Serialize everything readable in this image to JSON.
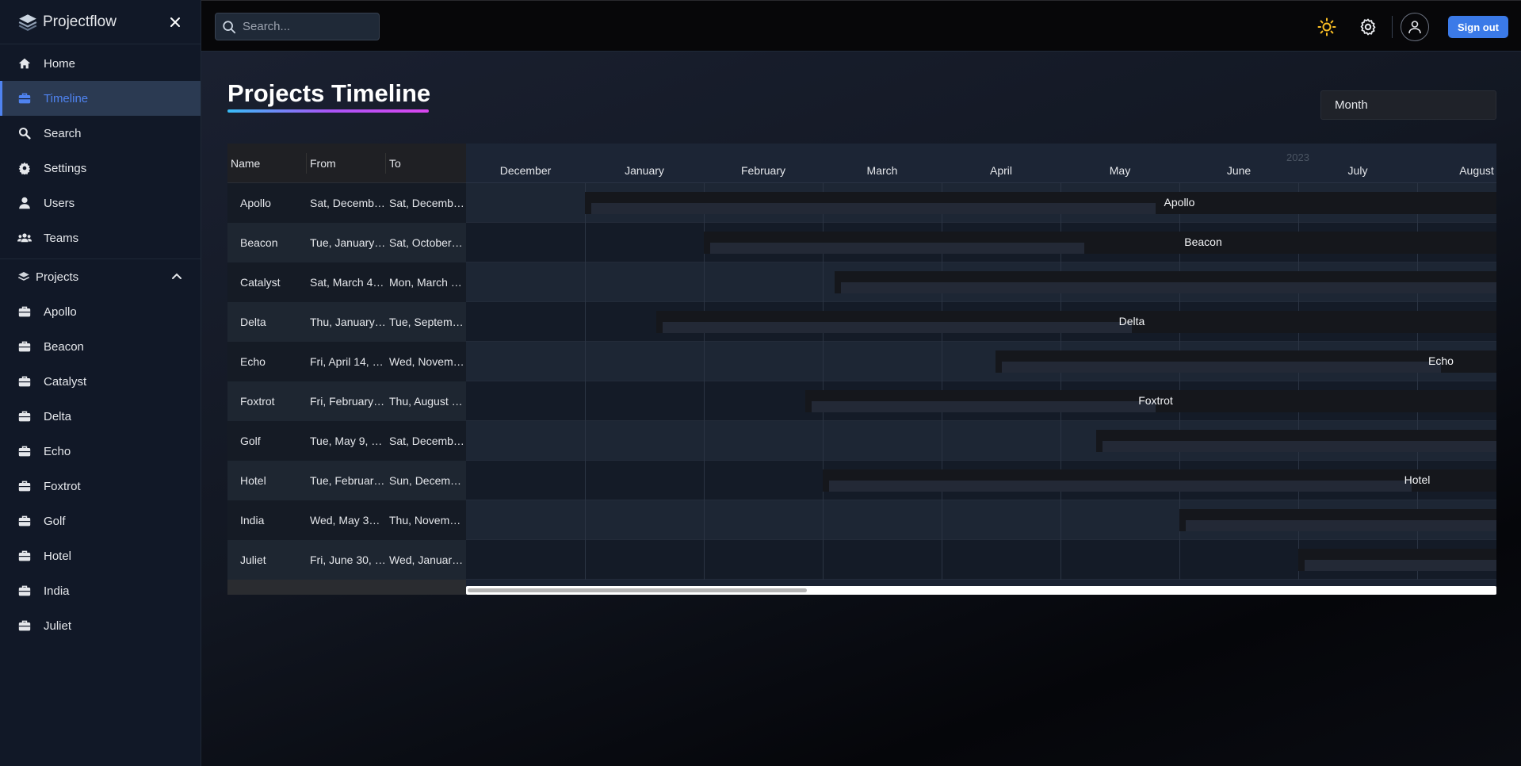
{
  "app": {
    "name": "Projectflow"
  },
  "search": {
    "placeholder": "Search..."
  },
  "nav": [
    {
      "label": "Home",
      "icon": "home-icon"
    },
    {
      "label": "Timeline",
      "icon": "briefcase-icon",
      "active": true
    },
    {
      "label": "Search",
      "icon": "search-icon"
    },
    {
      "label": "Settings",
      "icon": "gear-icon"
    },
    {
      "label": "Users",
      "icon": "user-icon"
    },
    {
      "label": "Teams",
      "icon": "users-icon"
    }
  ],
  "projects_header": "Projects",
  "projects": [
    "Apollo",
    "Beacon",
    "Catalyst",
    "Delta",
    "Echo",
    "Foxtrot",
    "Golf",
    "Hotel",
    "India",
    "Juliet"
  ],
  "topbar": {
    "signout": "Sign out"
  },
  "page": {
    "title": "Projects Timeline",
    "view": "Month"
  },
  "table": {
    "headers": {
      "name": "Name",
      "from": "From",
      "to": "To"
    },
    "rows": [
      {
        "name": "Apollo",
        "from": "Sat, Decemb…",
        "to": "Sat, Decemb…"
      },
      {
        "name": "Beacon",
        "from": "Tue, January…",
        "to": "Sat, October…"
      },
      {
        "name": "Catalyst",
        "from": "Sat, March 4…",
        "to": "Mon, March …"
      },
      {
        "name": "Delta",
        "from": "Thu, January…",
        "to": "Tue, Septem…"
      },
      {
        "name": "Echo",
        "from": "Fri, April 14, …",
        "to": "Wed, Novem…"
      },
      {
        "name": "Foxtrot",
        "from": "Fri, February…",
        "to": "Thu, August …"
      },
      {
        "name": "Golf",
        "from": "Tue, May 9, …",
        "to": "Sat, Decemb…"
      },
      {
        "name": "Hotel",
        "from": "Tue, Februar…",
        "to": "Sun, Decem…"
      },
      {
        "name": "India",
        "from": "Wed, May 3…",
        "to": "Thu, Novem…"
      },
      {
        "name": "Juliet",
        "from": "Fri, June 30, …",
        "to": "Wed, Januar…"
      }
    ]
  },
  "timeline": {
    "year": "2023",
    "months": [
      "December",
      "January",
      "February",
      "March",
      "April",
      "May",
      "June",
      "July",
      "August"
    ],
    "bars": [
      {
        "label": "Apollo",
        "start": 1.0,
        "end": 8.7,
        "fill_end": 5.8
      },
      {
        "label": "Beacon",
        "start": 2.0,
        "end": 8.7,
        "fill_end": 5.2
      },
      {
        "label": "Catalyst",
        "start": 3.1,
        "end": 8.7,
        "fill_end": 8.7
      },
      {
        "label": "Delta",
        "start": 1.6,
        "end": 8.7,
        "fill_end": 5.6
      },
      {
        "label": "Echo",
        "start": 4.45,
        "end": 8.7,
        "fill_end": 8.2
      },
      {
        "label": "Foxtrot",
        "start": 2.85,
        "end": 8.7,
        "fill_end": 5.8
      },
      {
        "label": "Golf",
        "start": 5.3,
        "end": 8.7,
        "fill_end": 8.7
      },
      {
        "label": "Hotel",
        "start": 3.0,
        "end": 8.7,
        "fill_end": 7.95
      },
      {
        "label": "India",
        "start": 6.0,
        "end": 8.7,
        "fill_end": 8.7
      },
      {
        "label": "Juliet",
        "start": 7.0,
        "end": 8.7,
        "fill_end": 8.7
      }
    ],
    "label_positions": [
      {
        "row": 0,
        "label": "Apollo",
        "at": 6.0
      },
      {
        "row": 1,
        "label": "Beacon",
        "at": 6.2
      },
      {
        "row": 3,
        "label": "Delta",
        "at": 5.6
      },
      {
        "row": 4,
        "label": "Echo",
        "at": 8.2
      },
      {
        "row": 5,
        "label": "Foxtrot",
        "at": 5.8
      },
      {
        "row": 7,
        "label": "Hotel",
        "at": 8.0
      }
    ]
  }
}
